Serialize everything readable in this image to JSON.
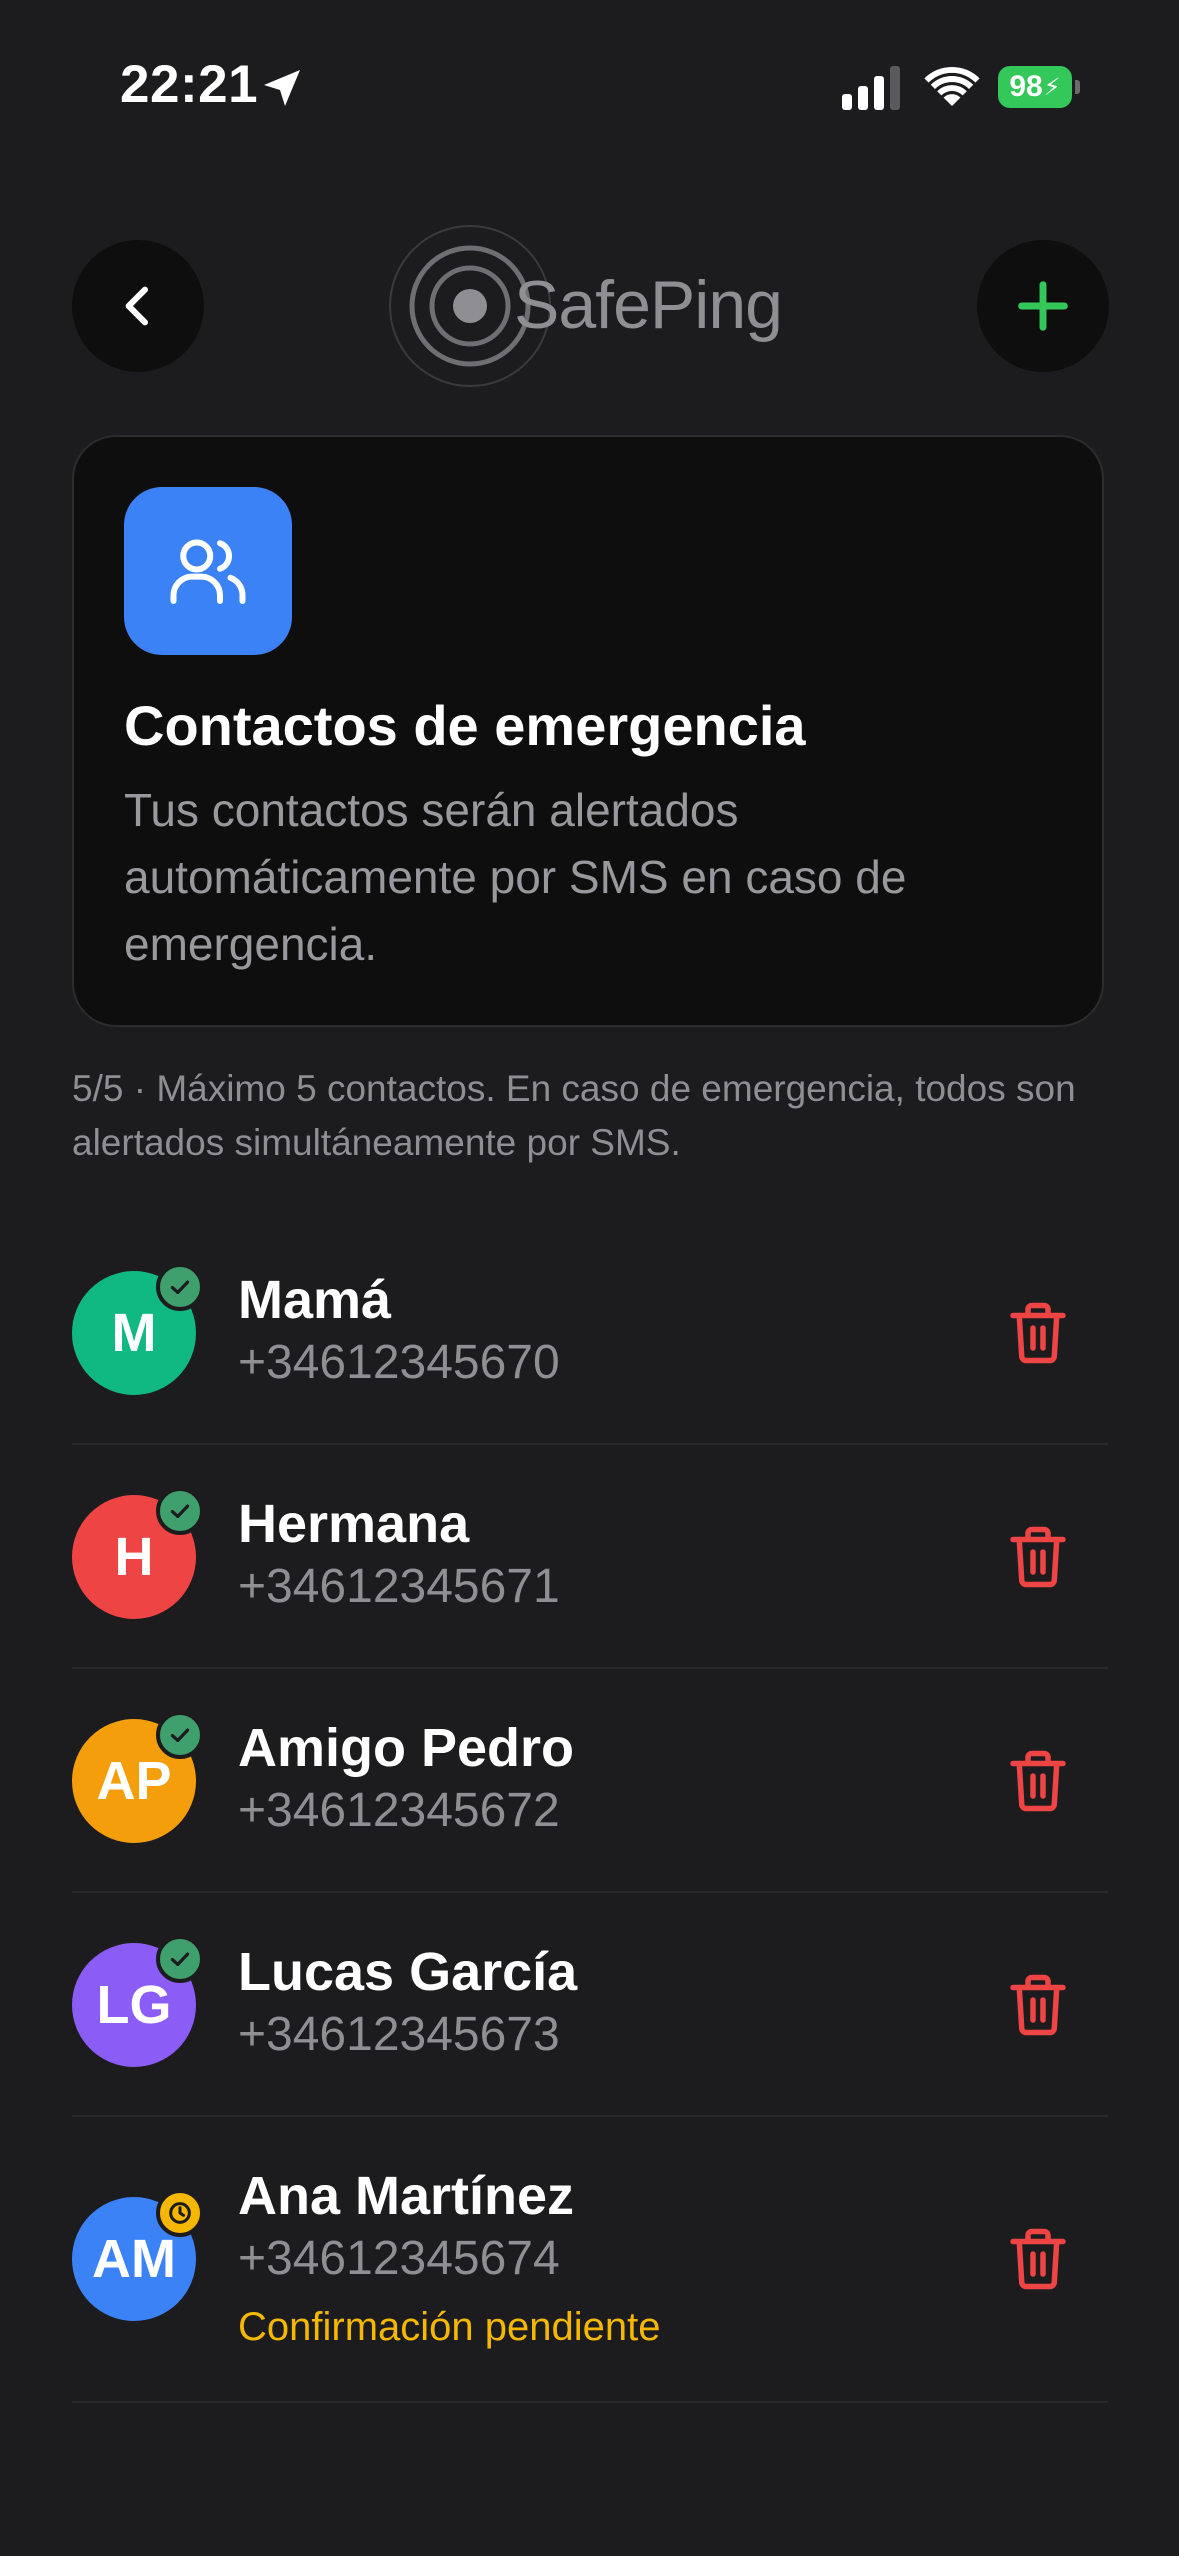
{
  "status_bar": {
    "time": "22:21",
    "battery": "98"
  },
  "header": {
    "logo_text": "SafePing",
    "back_icon": "chevron-left-icon",
    "add_icon": "plus-icon"
  },
  "info_card": {
    "icon": "users-icon",
    "title": "Contactos de emergencia",
    "description": "Tus contactos serán alertados automáticamente por SMS en caso de emergencia."
  },
  "limit_note": "5/5 · Máximo 5 contactos. En caso de emergencia, todos son alertados simultáneamente por SMS.",
  "contacts": [
    {
      "initials": "M",
      "name": "Mamá",
      "phone": "+34612345670",
      "status": "confirmed",
      "color": "#10b981"
    },
    {
      "initials": "H",
      "name": "Hermana",
      "phone": "+34612345671",
      "status": "confirmed",
      "color": "#ef4444"
    },
    {
      "initials": "AP",
      "name": "Amigo Pedro",
      "phone": "+34612345672",
      "status": "confirmed",
      "color": "#f59e0b"
    },
    {
      "initials": "LG",
      "name": "Lucas García",
      "phone": "+34612345673",
      "status": "confirmed",
      "color": "#8b5cf6"
    },
    {
      "initials": "AM",
      "name": "Ana Martínez",
      "phone": "+34612345674",
      "status": "pending",
      "status_text": "Confirmación pendiente",
      "color": "#3b82f6"
    }
  ],
  "colors": {
    "background": "#1c1c1e",
    "card": "#0e0e0f",
    "accent_green": "#34c759",
    "danger": "#ef4444",
    "pending": "#f5b700"
  }
}
